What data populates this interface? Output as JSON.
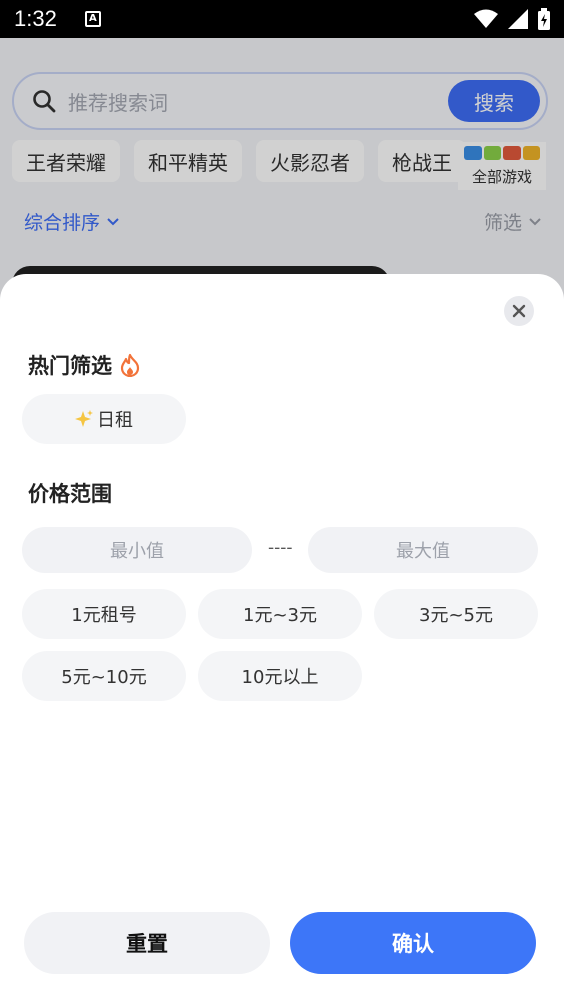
{
  "status_bar": {
    "time": "1:32",
    "notif_glyph": "A"
  },
  "background": {
    "search_placeholder": "推荐搜索词",
    "search_button": "搜索",
    "hot_games": [
      "王者荣耀",
      "和平精英",
      "火影忍者",
      "枪战王"
    ],
    "all_games_label": "全部游戏",
    "sort_label": "综合排序",
    "filter_label": "筛选"
  },
  "sheet": {
    "hot_filter_title": "热门筛选",
    "hot_filter_options": [
      {
        "label": "日租",
        "icon": "sparkle-icon"
      }
    ],
    "price_title": "价格范围",
    "min_placeholder": "最小值",
    "max_placeholder": "最大值",
    "range_separator": "----",
    "price_options": [
      "1元租号",
      "1元~3元",
      "3元~5元",
      "5元~10元",
      "10元以上"
    ],
    "reset_button": "重置",
    "confirm_button": "确认"
  },
  "colors": {
    "accent": "#3d76f8",
    "fire": "#f2733a",
    "sparkle": "#f5c542"
  }
}
